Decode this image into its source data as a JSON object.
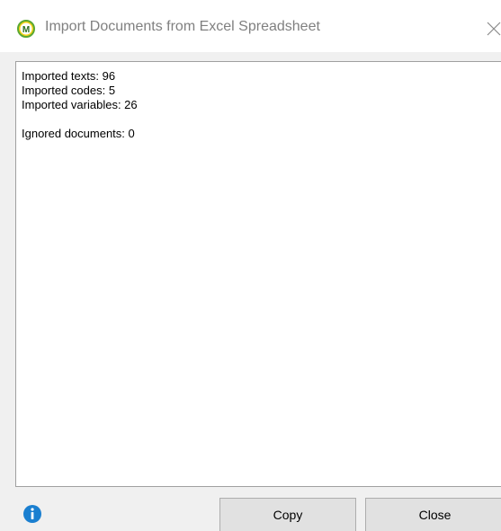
{
  "window": {
    "title": "Import Documents from Excel Spreadsheet",
    "app_icon": "maxqda-logo-icon",
    "close_icon": "close-icon"
  },
  "report": {
    "imported_texts": "Imported texts: 96",
    "imported_codes": "Imported codes: 5",
    "imported_variables": "Imported variables: 26",
    "ignored_documents": "Ignored documents: 0"
  },
  "footer": {
    "info_icon": "info-icon",
    "copy_label": "Copy",
    "close_label": "Close"
  },
  "colors": {
    "title_text": "#808080",
    "info_icon": "#1a7fd0",
    "logo_ring": "#5aa832",
    "dialog_bg": "#f0f0f0"
  }
}
